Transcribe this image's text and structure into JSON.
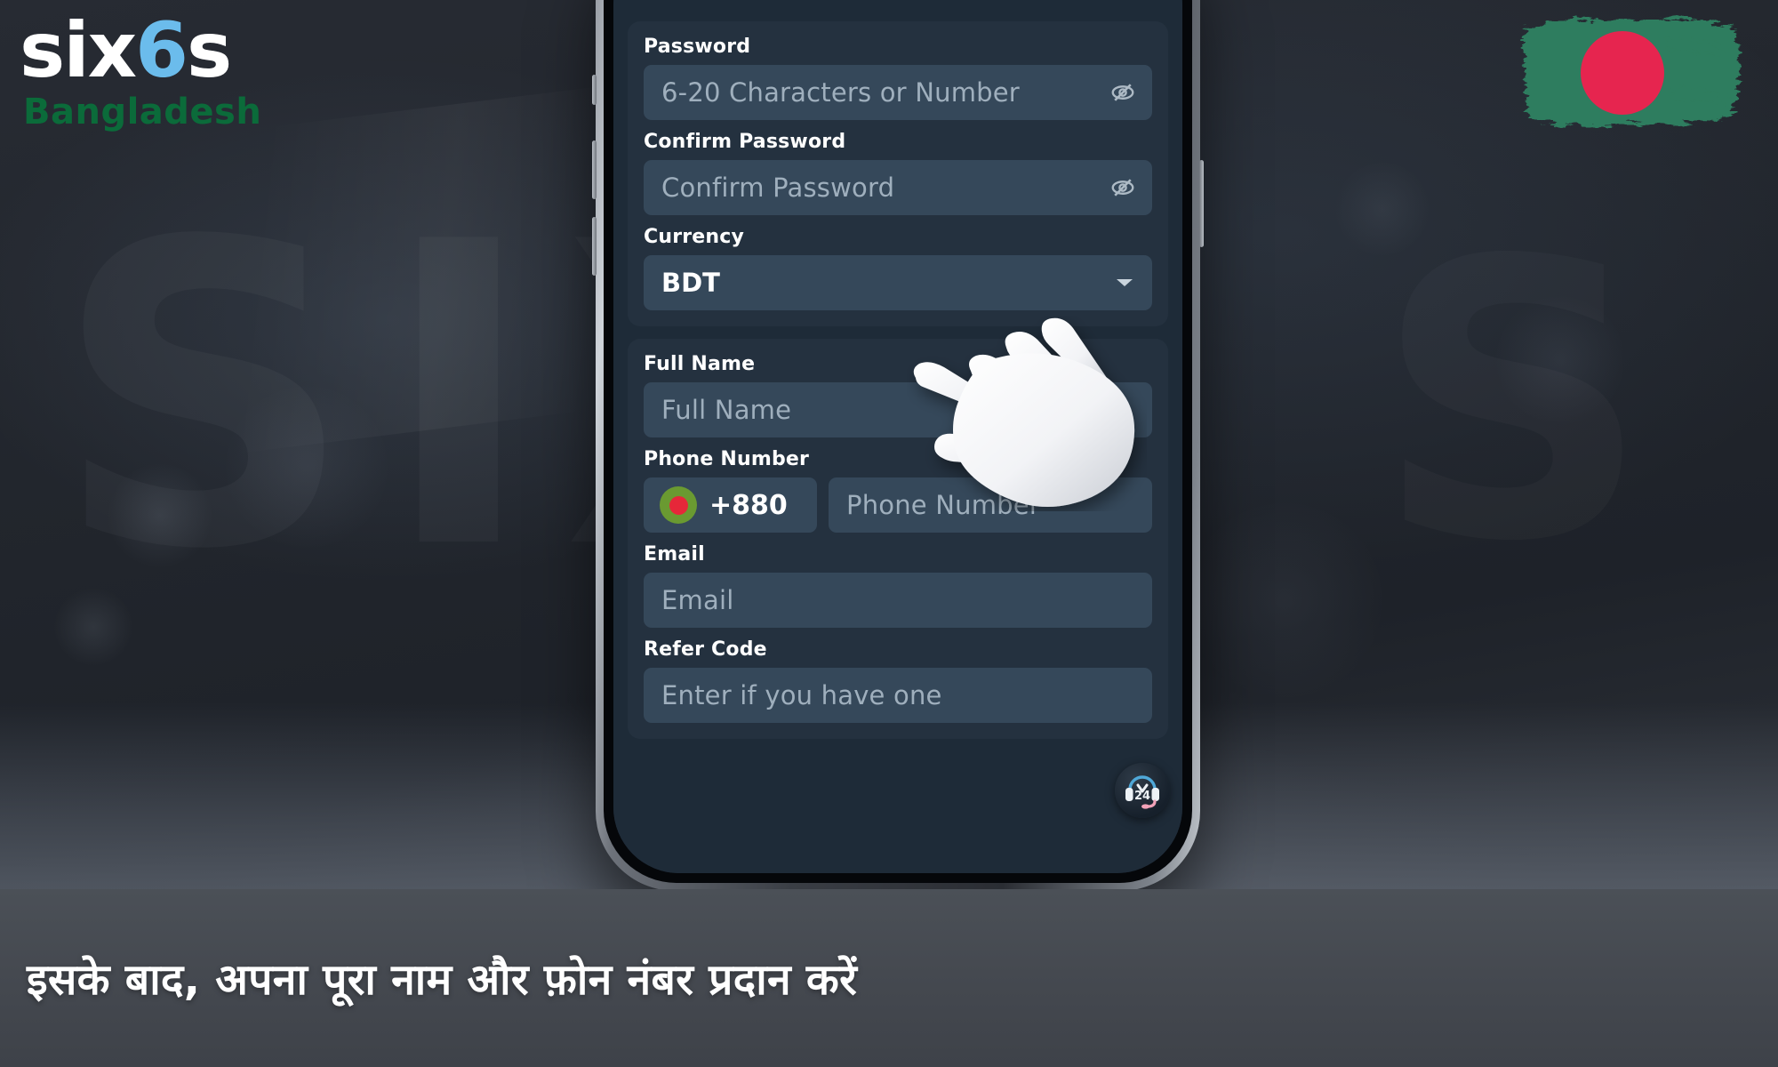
{
  "brand": {
    "name_part1": "six",
    "name_part2": "6",
    "name_part3": "s",
    "country": "Bangladesh",
    "accent_blue": "#6BBCEC",
    "accent_green": "#0B6B3A",
    "flag_green": "#2E7D5E",
    "flag_red": "#E6254F"
  },
  "watermark": {
    "text": "SIX",
    "text2": "S"
  },
  "form": {
    "cards": [
      {
        "fields": [
          {
            "label": "Password",
            "placeholder": "6-20 Characters or Number",
            "value": "",
            "icon": "eye-off-icon",
            "type": "password"
          },
          {
            "label": "Confirm Password",
            "placeholder": "Confirm Password",
            "value": "",
            "icon": "eye-off-icon",
            "type": "password"
          },
          {
            "label": "Currency",
            "placeholder": "",
            "value": "BDT",
            "icon": "chevron-down-icon",
            "type": "select"
          }
        ]
      },
      {
        "fields": [
          {
            "label": "Full Name",
            "placeholder": "Full Name",
            "value": "",
            "icon": "",
            "type": "text"
          },
          {
            "label": "Phone Number",
            "placeholder": "Phone Number",
            "value": "",
            "icon": "",
            "type": "phone",
            "country_code": "+880",
            "flag": "bangladesh-flag-icon"
          },
          {
            "label": "Email",
            "placeholder": "Email",
            "value": "",
            "icon": "",
            "type": "email"
          },
          {
            "label": "Refer Code",
            "placeholder": "Enter if you have one",
            "value": "",
            "icon": "",
            "type": "text"
          }
        ]
      }
    ]
  },
  "support": {
    "label": "24",
    "icon": "headset-24h-support-icon"
  },
  "cursor": {
    "icon": "hand-cursor-icon"
  },
  "caption": {
    "text": "इसके बाद, अपना पूरा नाम और फ़ोन नंबर प्रदान करें"
  }
}
